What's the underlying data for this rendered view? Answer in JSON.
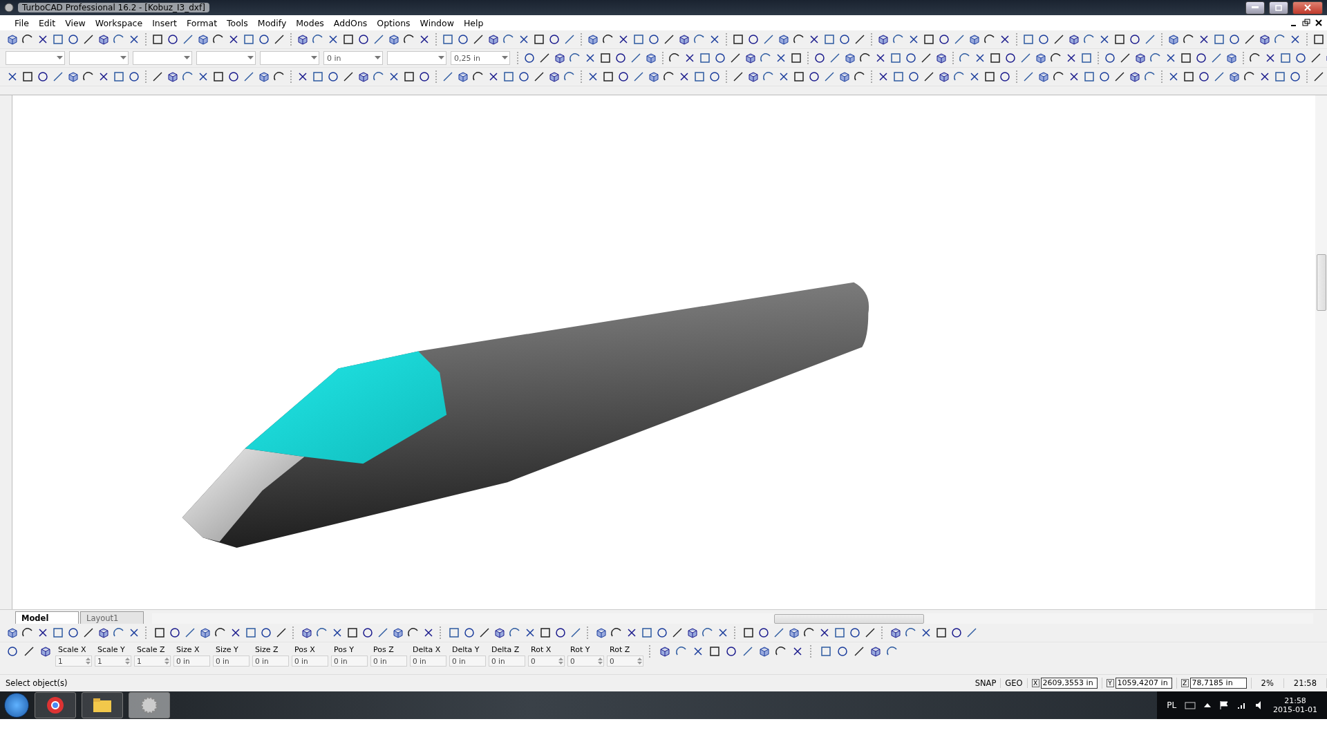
{
  "window": {
    "title": "TurboCAD Professional 16.2 - [Kobuz_I3_dxf]"
  },
  "menu": [
    {
      "label": "File"
    },
    {
      "label": "Edit"
    },
    {
      "label": "View"
    },
    {
      "label": "Workspace"
    },
    {
      "label": "Insert"
    },
    {
      "label": "Format"
    },
    {
      "label": "Tools"
    },
    {
      "label": "Modify"
    },
    {
      "label": "Modes"
    },
    {
      "label": "AddOns"
    },
    {
      "label": "Options"
    },
    {
      "label": "Window"
    },
    {
      "label": "Help"
    }
  ],
  "toolbar_combos": [
    {
      "kind": "combo"
    },
    {
      "kind": "combo"
    },
    {
      "kind": "combo"
    },
    {
      "kind": "combo"
    },
    {
      "kind": "combo"
    },
    {
      "kind": "combo",
      "value": "0 in"
    },
    {
      "kind": "combo"
    },
    {
      "kind": "combo",
      "value": "0,25 in"
    }
  ],
  "tabs": [
    {
      "label": "Model",
      "selected": true
    },
    {
      "label": "Layout1",
      "selected": false
    }
  ],
  "properties": [
    {
      "label": "Scale X",
      "value": "1",
      "spinner": true
    },
    {
      "label": "Scale Y",
      "value": "1",
      "spinner": true
    },
    {
      "label": "Scale Z",
      "value": "1",
      "spinner": true
    },
    {
      "label": "Size X",
      "value": "0 in",
      "spinner": false
    },
    {
      "label": "Size Y",
      "value": "0 in",
      "spinner": false
    },
    {
      "label": "Size Z",
      "value": "0 in",
      "spinner": false
    },
    {
      "label": "Pos X",
      "value": "0 in",
      "spinner": false
    },
    {
      "label": "Pos Y",
      "value": "0 in",
      "spinner": false
    },
    {
      "label": "Pos Z",
      "value": "0 in",
      "spinner": false
    },
    {
      "label": "Delta X",
      "value": "0 in",
      "spinner": false
    },
    {
      "label": "Delta Y",
      "value": "0 in",
      "spinner": false
    },
    {
      "label": "Delta Z",
      "value": "0 in",
      "spinner": false
    },
    {
      "label": "Rot X",
      "value": "0",
      "spinner": true
    },
    {
      "label": "Rot Y",
      "value": "0",
      "spinner": true
    },
    {
      "label": "Rot Z",
      "value": "0",
      "spinner": true
    }
  ],
  "status_bar": {
    "message": "Select object(s)",
    "indicators": [
      "SNAP",
      "GEO"
    ],
    "coordinates": [
      {
        "axis": "X",
        "value": "2609,3553 in"
      },
      {
        "axis": "Y",
        "value": "1059,4207 in"
      },
      {
        "axis": "Z",
        "value": "78,7185 in"
      }
    ],
    "zoom": "2%",
    "time": "21:58"
  },
  "taskbar": {
    "language": "PL",
    "time": "21:58",
    "date": "2015-01-01"
  }
}
